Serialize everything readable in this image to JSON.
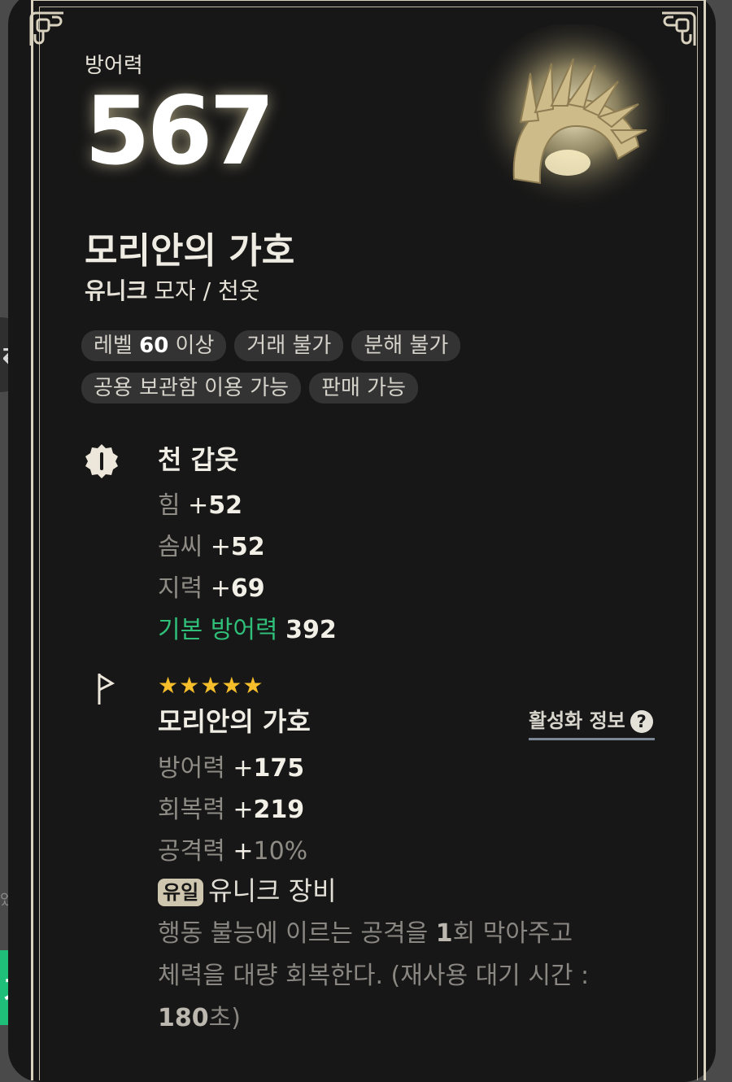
{
  "side": {
    "swap_icon": "⇄",
    "left_fragment": "었",
    "button_label": "기"
  },
  "defense": {
    "label": "방어력",
    "value": "567"
  },
  "item": {
    "image": "crown-icon",
    "name": "모리안의 가호",
    "grade": "유니크",
    "type": "모자 / 천옷"
  },
  "tags": {
    "row1": [
      {
        "pre": "레벨 ",
        "bold": "60",
        "post": " 이상"
      },
      {
        "pre": "거래 불가",
        "bold": "",
        "post": ""
      },
      {
        "pre": "분해 불가",
        "bold": "",
        "post": ""
      }
    ],
    "row2": [
      {
        "pre": "공용 보관함 이용 가능",
        "bold": "",
        "post": ""
      },
      {
        "pre": "판매 가능",
        "bold": "",
        "post": ""
      }
    ]
  },
  "armor": {
    "icon": "armor-badge-icon",
    "title": "천 갑옷",
    "stats": [
      {
        "label": "힘",
        "value": "52"
      },
      {
        "label": "솜씨",
        "value": "52"
      },
      {
        "label": "지력",
        "value": "69"
      }
    ],
    "base_label": "기본 방어력",
    "base_value": "392"
  },
  "set": {
    "icon": "flag-icon",
    "stars": "★★★★★",
    "rating": 5,
    "title": "모리안의 가호",
    "info_label": "활성화 정보",
    "info_icon": "?",
    "stats": [
      {
        "label": "방어력",
        "value": "175"
      },
      {
        "label": "회복력",
        "value": "219"
      },
      {
        "label": "공격력",
        "value": "10%"
      }
    ],
    "badge": "유일",
    "unique_text": "유니크 장비",
    "desc_line1_a": "행동 불능에 이르는 공격을 ",
    "desc_line1_b": "1",
    "desc_line1_c": "회 막아주고",
    "desc_line2": "체력을 대량 회복한다. (재사용 대기 시간 :",
    "desc_line3_a": "180",
    "desc_line3_b": "초)"
  },
  "colors": {
    "green": "#2fbf78",
    "star": "#f6be2a",
    "accent_button": "#1fbf7a"
  }
}
